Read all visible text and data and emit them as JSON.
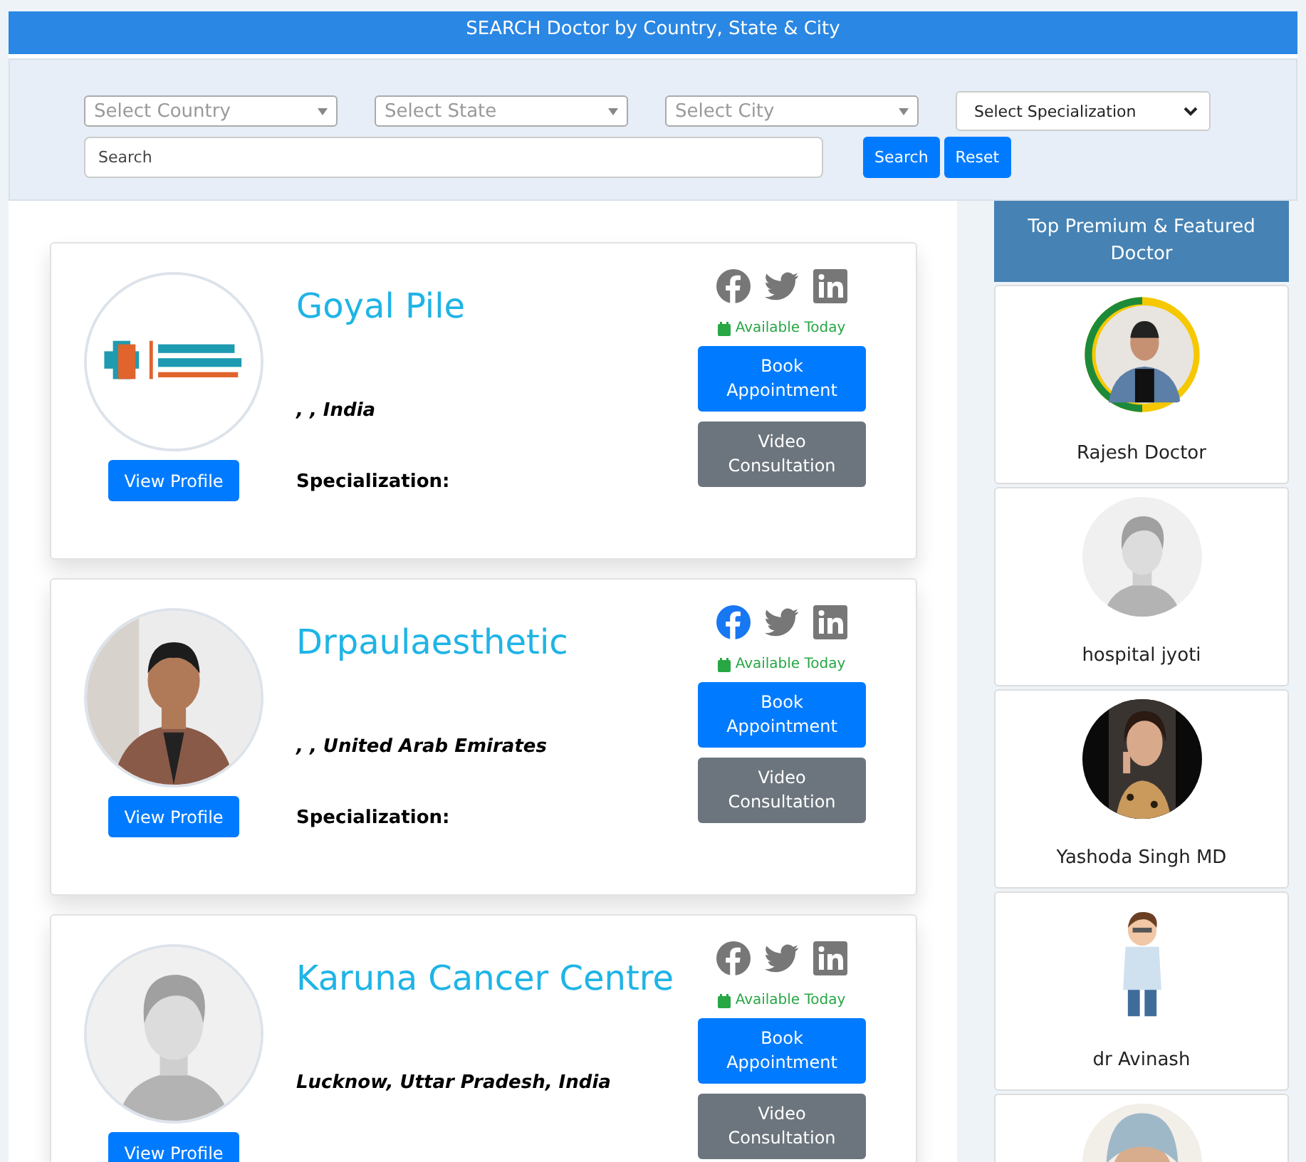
{
  "header": {
    "title": "SEARCH Doctor by Country, State & City"
  },
  "filters": {
    "selects": [
      {
        "kind": "combo",
        "placeholder": "Select Country"
      },
      {
        "kind": "combo",
        "placeholder": "Select State"
      },
      {
        "kind": "combo",
        "placeholder": "Select City"
      },
      {
        "kind": "native",
        "placeholder": "Select Specialization"
      }
    ],
    "search": {
      "placeholder": "Search"
    },
    "buttons": [
      "Search",
      "Reset"
    ]
  },
  "doctors": [
    {
      "name": "Goyal Pile",
      "location": ", , India",
      "specialization": "Specialization:",
      "view_profile": "View Profile",
      "socials": [
        {
          "kind": "facebook",
          "hovered": false
        },
        {
          "kind": "twitter",
          "hovered": false
        },
        {
          "kind": "linkedin",
          "hovered": false
        }
      ],
      "availability": "Available Today",
      "book": "Book Appointment",
      "video": "Video Consultation"
    },
    {
      "name": "Drpaulaesthetic",
      "location": ", , United Arab Emirates",
      "specialization": "Specialization:",
      "view_profile": "View Profile",
      "socials": [
        {
          "kind": "facebook",
          "hovered": true
        },
        {
          "kind": "twitter",
          "hovered": false
        },
        {
          "kind": "linkedin",
          "hovered": false
        }
      ],
      "availability": "Available Today",
      "book": "Book Appointment",
      "video": "Video Consultation"
    },
    {
      "name": "Karuna Cancer Centre",
      "location": "Lucknow, Uttar Pradesh, India",
      "view_profile": "View Profile",
      "socials": [
        {
          "kind": "facebook",
          "hovered": false
        },
        {
          "kind": "twitter",
          "hovered": false
        },
        {
          "kind": "linkedin",
          "hovered": false
        }
      ],
      "availability": "Available Today",
      "book": "Book Appointment",
      "video": "Video Consultation"
    }
  ],
  "sidebar": {
    "title": "Top Premium & Featured Doctor",
    "items": [
      {
        "name": "Rajesh Doctor"
      },
      {
        "name": "hospital jyoti"
      },
      {
        "name": "Yashoda Singh MD"
      },
      {
        "name": "dr Avinash"
      },
      {
        "kind": "picture"
      }
    ]
  }
}
